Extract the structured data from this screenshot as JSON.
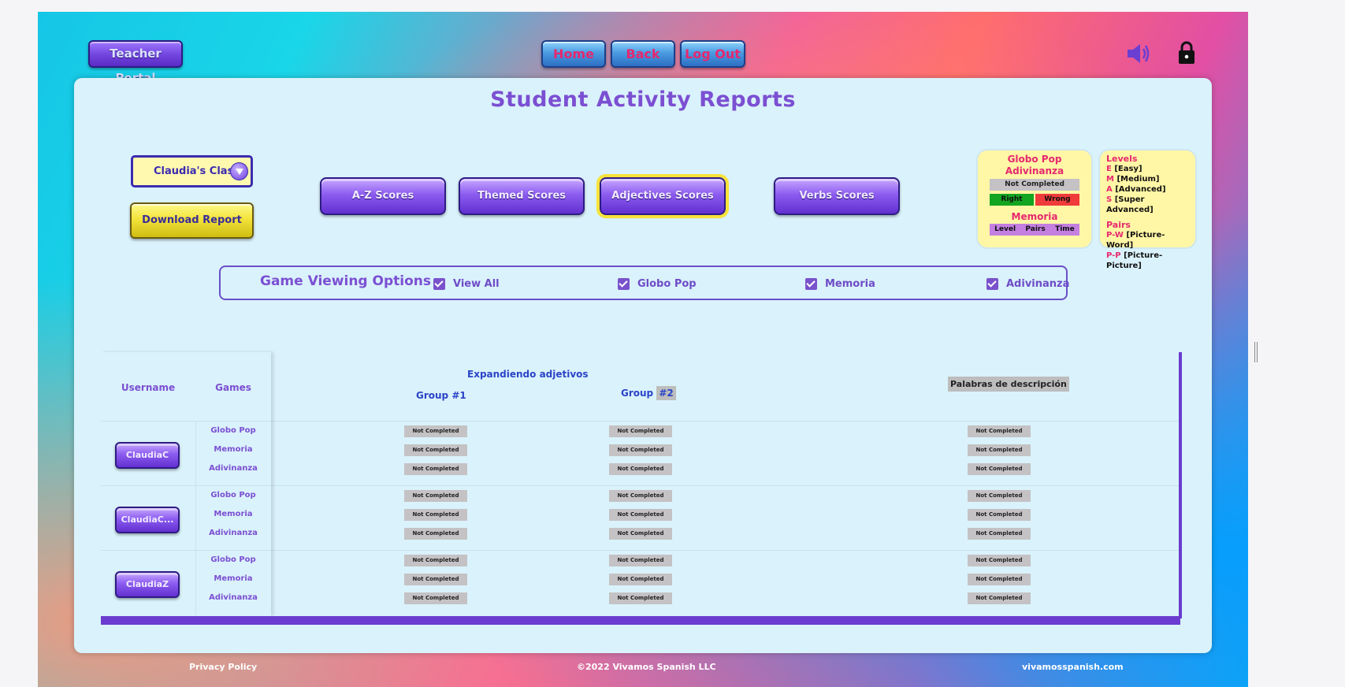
{
  "header": {
    "teacher_portal": "Teacher Portal",
    "nav": {
      "home": "Home",
      "back": "Back",
      "logout": "Log Out"
    }
  },
  "panel": {
    "title": "Student Activity Reports",
    "class_select": "Claudia's Class",
    "download": "Download Report",
    "tabs": [
      "A-Z Scores",
      "Themed Scores",
      "Adjectives Scores",
      "Verbs Scores"
    ],
    "active_tab": "Adjectives Scores"
  },
  "legend": {
    "games_title_1": "Globo Pop",
    "games_title_2": "Adivinanza",
    "not_completed": "Not Completed",
    "right": "Right",
    "wrong": "Wrong",
    "memoria": "Memoria",
    "level": "Level",
    "pairs": "Pairs",
    "time": "Time",
    "levels_title": "Levels",
    "levels": [
      {
        "code": "E",
        "text": "[Easy]"
      },
      {
        "code": "M",
        "text": "[Medium]"
      },
      {
        "code": "A",
        "text": "[Advanced]"
      },
      {
        "code": "S",
        "text": "[Super Advanced]"
      }
    ],
    "pairs_title": "Pairs",
    "pairs_items": [
      {
        "code": "P-W",
        "text": "[Picture-Word]"
      },
      {
        "code": "P-P",
        "text": "[Picture-Picture]"
      }
    ]
  },
  "viewing": {
    "title": "Game Viewing Options",
    "options": [
      {
        "label": "View All",
        "checked": true
      },
      {
        "label": "Globo Pop",
        "checked": true
      },
      {
        "label": "Memoria",
        "checked": true
      },
      {
        "label": "Adivinanza",
        "checked": true
      }
    ]
  },
  "report": {
    "col_username": "Username",
    "col_games": "Games",
    "group_title": "Expandiendo adjetivos",
    "group1": "Group #1",
    "group2_prefix": "Group",
    "group2_hl": "#2",
    "palabras": "Palabras de descripción",
    "games": [
      "Globo Pop",
      "Memoria",
      "Adivinanza"
    ],
    "students": [
      {
        "username": "ClaudiaC",
        "cells": [
          "Not Completed",
          "Not Completed",
          "Not Completed",
          "Not Completed",
          "Not Completed",
          "Not Completed",
          "Not Completed",
          "Not Completed",
          "Not Completed"
        ]
      },
      {
        "username": "ClaudiaC...",
        "cells": [
          "Not Completed",
          "Not Completed",
          "Not Completed",
          "Not Completed",
          "Not Completed",
          "Not Completed",
          "Not Completed",
          "Not Completed",
          "Not Completed"
        ]
      },
      {
        "username": "ClaudiaZ",
        "cells": [
          "Not Completed",
          "Not Completed",
          "Not Completed",
          "Not Completed",
          "Not Completed",
          "Not Completed",
          "Not Completed",
          "Not Completed",
          "Not Completed"
        ]
      }
    ]
  },
  "footer": {
    "privacy": "Privacy Policy",
    "copyright": "©2022 Vivamos Spanish LLC",
    "site": "vivamosspanish.com"
  },
  "colors": {
    "accent_purple": "#7b4fd2",
    "nav_text_pink": "#e6286e",
    "not_completed_gray": "#c4c2c4",
    "panel_bg": "#daf2fb"
  }
}
